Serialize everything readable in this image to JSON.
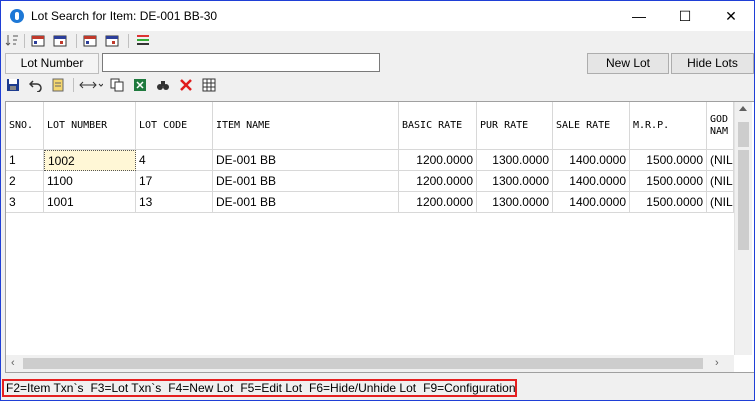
{
  "window": {
    "title": "Lot Search for Item: DE-001 BB-30",
    "minimize": "—",
    "maximize": "☐",
    "close": "✕"
  },
  "toolbar1": {
    "icons": [
      "sort-icon",
      "calendar-red-icon",
      "calendar-blue-icon",
      "calendar-red-2-icon",
      "calendar-blue-2-icon",
      "list-color-icon"
    ]
  },
  "search": {
    "label": "Lot Number",
    "value": "",
    "new_lot": "New Lot",
    "hide_lots": "Hide Lots"
  },
  "toolbar2": {
    "icons": [
      "save-icon",
      "undo-icon",
      "notes-icon",
      "column-resize-icon",
      "copy-icon",
      "excel-icon",
      "binoculars-icon",
      "delete-icon",
      "grid-icon"
    ]
  },
  "grid": {
    "columns": [
      "SNO.",
      "LOT NUMBER",
      "LOT CODE",
      "ITEM NAME",
      "BASIC RATE",
      "PUR RATE",
      "SALE RATE",
      "M.R.P.",
      "GOD NAM"
    ],
    "rows": [
      [
        "1",
        "1002",
        "4",
        "DE-001 BB",
        "1200.0000",
        "1300.0000",
        "1400.0000",
        "1500.0000",
        "(NIL"
      ],
      [
        "2",
        "1100",
        "17",
        "DE-001 BB",
        "1200.0000",
        "1300.0000",
        "1400.0000",
        "1500.0000",
        "(NIL"
      ],
      [
        "3",
        "1001",
        "13",
        "DE-001 BB",
        "1200.0000",
        "1300.0000",
        "1400.0000",
        "1500.0000",
        "(NIL"
      ]
    ]
  },
  "status": [
    "F2=Item Txn`s",
    "F3=Lot Txn`s",
    "F4=New Lot",
    "F5=Edit Lot",
    "F6=Hide/Unhide Lot",
    "F9=Configuration"
  ]
}
